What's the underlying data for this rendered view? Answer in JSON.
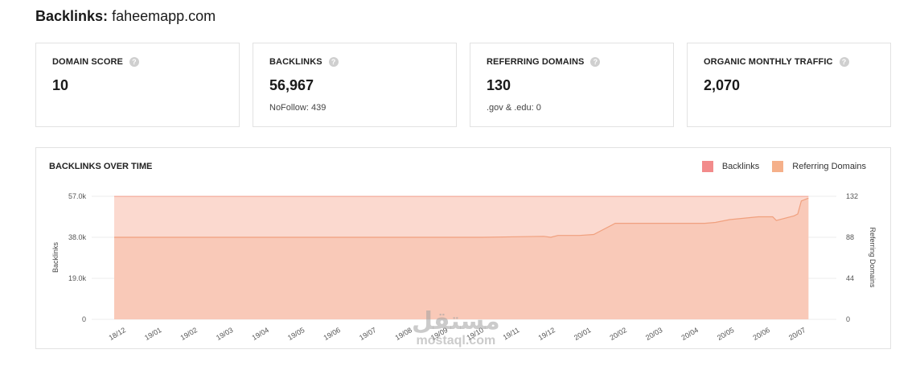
{
  "header": {
    "prefix": "Backlinks:",
    "domain": "faheemapp.com"
  },
  "cards": [
    {
      "label": "DOMAIN SCORE",
      "value": "10",
      "sub": ""
    },
    {
      "label": "BACKLINKS",
      "value": "56,967",
      "sub": "NoFollow: 439"
    },
    {
      "label": "REFERRING DOMAINS",
      "value": "130",
      "sub": ".gov & .edu: 0"
    },
    {
      "label": "ORGANIC MONTHLY TRAFFIC",
      "value": "2,070",
      "sub": ""
    }
  ],
  "help_icon": "?",
  "chart": {
    "title": "BACKLINKS OVER TIME",
    "legend": [
      {
        "name": "Backlinks",
        "color": "#f28b8b"
      },
      {
        "name": "Referring Domains",
        "color": "#f5b08a"
      }
    ]
  },
  "chart_data": {
    "type": "area",
    "title": "BACKLINKS OVER TIME",
    "ylabel": "Backlinks",
    "y2label": "Referring Domains",
    "ylim": [
      0,
      57000
    ],
    "y2lim": [
      0,
      132
    ],
    "y_ticks": [
      "0",
      "19.0k",
      "38.0k",
      "57.0k"
    ],
    "y2_ticks": [
      "0",
      "44",
      "88",
      "132"
    ],
    "x_ticks": [
      "18/12",
      "19/01",
      "19/02",
      "19/03",
      "19/04",
      "19/05",
      "19/06",
      "19/07",
      "19/08",
      "19/09",
      "19/10",
      "19/11",
      "19/12",
      "20/01",
      "20/02",
      "20/03",
      "20/04",
      "20/05",
      "20/06",
      "20/07"
    ],
    "legend_position": "top-right",
    "series": [
      {
        "name": "Backlinks",
        "axis": "left",
        "x": [
          0,
          19.4
        ],
        "values": [
          56967,
          56967
        ]
      },
      {
        "name": "Referring Domains",
        "axis": "right",
        "x": [
          0,
          10.3,
          12.0,
          12.2,
          12.4,
          13.0,
          13.4,
          13.6,
          14.0,
          14.5,
          15.5,
          16.5,
          16.8,
          17.2,
          18.0,
          18.4,
          18.5,
          19.0,
          19.1,
          19.2,
          19.4
        ],
        "values": [
          88,
          88,
          89,
          88,
          90,
          90,
          91,
          95,
          103,
          103,
          103,
          103,
          104,
          107,
          110,
          110,
          106,
          111,
          113,
          127,
          130
        ]
      }
    ],
    "grid": true
  },
  "watermark": {
    "ar": "مستقل",
    "en": "mostaql.com"
  }
}
